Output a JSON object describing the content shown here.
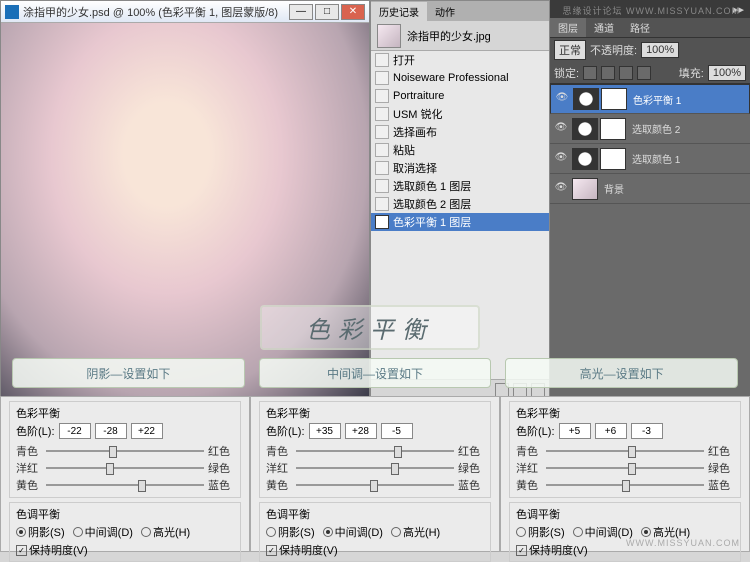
{
  "watermark_top": "思缘设计论坛  WWW.MISSYUAN.COM",
  "watermark_bottom": "WWW.MISSYUAN.COM",
  "doc_window": {
    "title": "涂指甲的少女.psd @ 100% (色彩平衡 1, 图层蒙版/8)"
  },
  "history": {
    "tab1": "历史记录",
    "tab2": "动作",
    "file": "涂指甲的少女.jpg",
    "items": [
      "打开",
      "Noiseware Professional",
      "Portraiture",
      "USM 锐化",
      "选择画布",
      "粘贴",
      "取消选择",
      "选取颜色 1 图层",
      "选取颜色 2 图层",
      "色彩平衡 1 图层"
    ]
  },
  "layers": {
    "top_label": "",
    "tabs": [
      "图层",
      "通道",
      "路径"
    ],
    "blend": "正常",
    "opacity_label": "不透明度:",
    "opacity": "100%",
    "lock_label": "锁定:",
    "fill_label": "填充:",
    "fill": "100%",
    "rows": [
      {
        "name": "色彩平衡 1",
        "type": "adj"
      },
      {
        "name": "选取颜色 2",
        "type": "adj"
      },
      {
        "name": "选取颜色 1",
        "type": "adj"
      },
      {
        "name": "背景",
        "type": "img"
      }
    ]
  },
  "overlay_title": "色彩平衡",
  "sections": [
    "阴影—设置如下",
    "中间调—设置如下",
    "高光—设置如下"
  ],
  "cb": {
    "group1_title": "色彩平衡",
    "levels_label": "色阶(L):",
    "pair_cyan": "青色",
    "pair_red": "红色",
    "pair_magenta": "洋红",
    "pair_green": "绿色",
    "pair_yellow": "黄色",
    "pair_blue": "蓝色",
    "group2_title": "色调平衡",
    "radio_shadow": "阴影(S)",
    "radio_mid": "中间调(D)",
    "radio_high": "高光(H)",
    "preserve": "保持明度(V)",
    "values": {
      "shadow": [
        "-22",
        "-28",
        "+22"
      ],
      "mid": [
        "+35",
        "+28",
        "-5"
      ],
      "high": [
        "+5",
        "+6",
        "-3"
      ]
    }
  }
}
